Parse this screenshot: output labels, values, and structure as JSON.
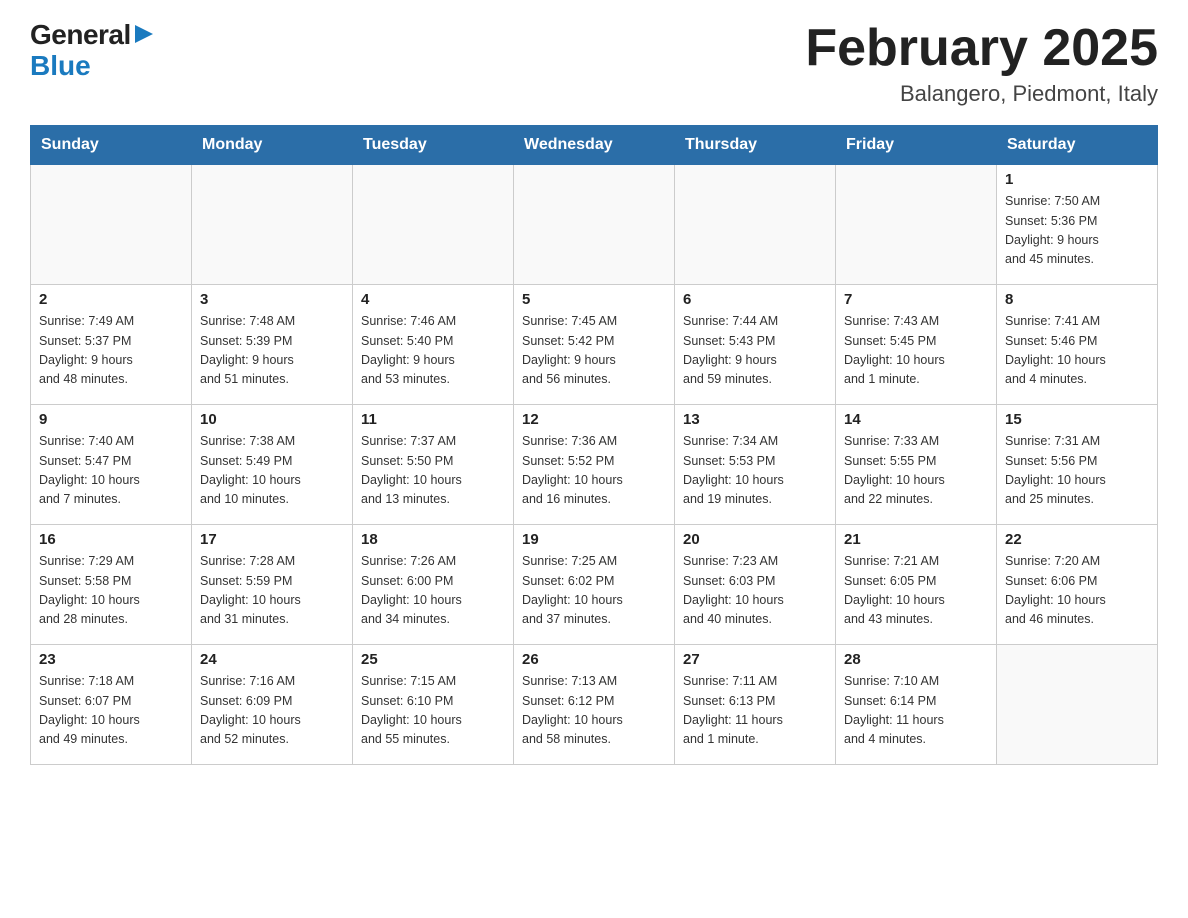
{
  "logo": {
    "general": "General",
    "blue": "Blue"
  },
  "title": "February 2025",
  "location": "Balangero, Piedmont, Italy",
  "weekdays": [
    "Sunday",
    "Monday",
    "Tuesday",
    "Wednesday",
    "Thursday",
    "Friday",
    "Saturday"
  ],
  "weeks": [
    [
      {
        "day": "",
        "info": ""
      },
      {
        "day": "",
        "info": ""
      },
      {
        "day": "",
        "info": ""
      },
      {
        "day": "",
        "info": ""
      },
      {
        "day": "",
        "info": ""
      },
      {
        "day": "",
        "info": ""
      },
      {
        "day": "1",
        "info": "Sunrise: 7:50 AM\nSunset: 5:36 PM\nDaylight: 9 hours\nand 45 minutes."
      }
    ],
    [
      {
        "day": "2",
        "info": "Sunrise: 7:49 AM\nSunset: 5:37 PM\nDaylight: 9 hours\nand 48 minutes."
      },
      {
        "day": "3",
        "info": "Sunrise: 7:48 AM\nSunset: 5:39 PM\nDaylight: 9 hours\nand 51 minutes."
      },
      {
        "day": "4",
        "info": "Sunrise: 7:46 AM\nSunset: 5:40 PM\nDaylight: 9 hours\nand 53 minutes."
      },
      {
        "day": "5",
        "info": "Sunrise: 7:45 AM\nSunset: 5:42 PM\nDaylight: 9 hours\nand 56 minutes."
      },
      {
        "day": "6",
        "info": "Sunrise: 7:44 AM\nSunset: 5:43 PM\nDaylight: 9 hours\nand 59 minutes."
      },
      {
        "day": "7",
        "info": "Sunrise: 7:43 AM\nSunset: 5:45 PM\nDaylight: 10 hours\nand 1 minute."
      },
      {
        "day": "8",
        "info": "Sunrise: 7:41 AM\nSunset: 5:46 PM\nDaylight: 10 hours\nand 4 minutes."
      }
    ],
    [
      {
        "day": "9",
        "info": "Sunrise: 7:40 AM\nSunset: 5:47 PM\nDaylight: 10 hours\nand 7 minutes."
      },
      {
        "day": "10",
        "info": "Sunrise: 7:38 AM\nSunset: 5:49 PM\nDaylight: 10 hours\nand 10 minutes."
      },
      {
        "day": "11",
        "info": "Sunrise: 7:37 AM\nSunset: 5:50 PM\nDaylight: 10 hours\nand 13 minutes."
      },
      {
        "day": "12",
        "info": "Sunrise: 7:36 AM\nSunset: 5:52 PM\nDaylight: 10 hours\nand 16 minutes."
      },
      {
        "day": "13",
        "info": "Sunrise: 7:34 AM\nSunset: 5:53 PM\nDaylight: 10 hours\nand 19 minutes."
      },
      {
        "day": "14",
        "info": "Sunrise: 7:33 AM\nSunset: 5:55 PM\nDaylight: 10 hours\nand 22 minutes."
      },
      {
        "day": "15",
        "info": "Sunrise: 7:31 AM\nSunset: 5:56 PM\nDaylight: 10 hours\nand 25 minutes."
      }
    ],
    [
      {
        "day": "16",
        "info": "Sunrise: 7:29 AM\nSunset: 5:58 PM\nDaylight: 10 hours\nand 28 minutes."
      },
      {
        "day": "17",
        "info": "Sunrise: 7:28 AM\nSunset: 5:59 PM\nDaylight: 10 hours\nand 31 minutes."
      },
      {
        "day": "18",
        "info": "Sunrise: 7:26 AM\nSunset: 6:00 PM\nDaylight: 10 hours\nand 34 minutes."
      },
      {
        "day": "19",
        "info": "Sunrise: 7:25 AM\nSunset: 6:02 PM\nDaylight: 10 hours\nand 37 minutes."
      },
      {
        "day": "20",
        "info": "Sunrise: 7:23 AM\nSunset: 6:03 PM\nDaylight: 10 hours\nand 40 minutes."
      },
      {
        "day": "21",
        "info": "Sunrise: 7:21 AM\nSunset: 6:05 PM\nDaylight: 10 hours\nand 43 minutes."
      },
      {
        "day": "22",
        "info": "Sunrise: 7:20 AM\nSunset: 6:06 PM\nDaylight: 10 hours\nand 46 minutes."
      }
    ],
    [
      {
        "day": "23",
        "info": "Sunrise: 7:18 AM\nSunset: 6:07 PM\nDaylight: 10 hours\nand 49 minutes."
      },
      {
        "day": "24",
        "info": "Sunrise: 7:16 AM\nSunset: 6:09 PM\nDaylight: 10 hours\nand 52 minutes."
      },
      {
        "day": "25",
        "info": "Sunrise: 7:15 AM\nSunset: 6:10 PM\nDaylight: 10 hours\nand 55 minutes."
      },
      {
        "day": "26",
        "info": "Sunrise: 7:13 AM\nSunset: 6:12 PM\nDaylight: 10 hours\nand 58 minutes."
      },
      {
        "day": "27",
        "info": "Sunrise: 7:11 AM\nSunset: 6:13 PM\nDaylight: 11 hours\nand 1 minute."
      },
      {
        "day": "28",
        "info": "Sunrise: 7:10 AM\nSunset: 6:14 PM\nDaylight: 11 hours\nand 4 minutes."
      },
      {
        "day": "",
        "info": ""
      }
    ]
  ]
}
